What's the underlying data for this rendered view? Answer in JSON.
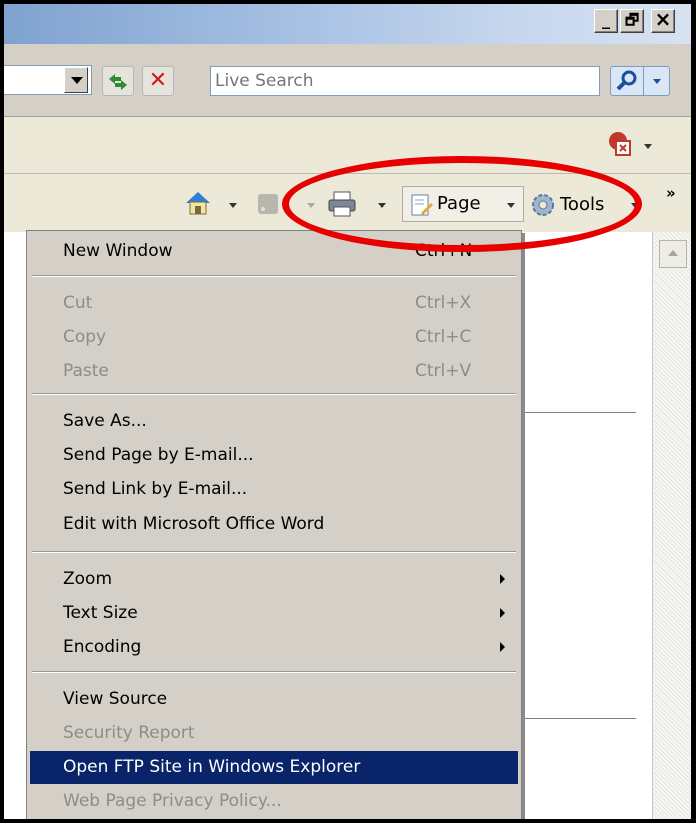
{
  "window": {
    "minimize_label": "_",
    "restore_label": "🗗",
    "close_label": "×"
  },
  "address_bar": {
    "search_placeholder": "Live Search",
    "refresh_icon": "refresh-icon",
    "stop_icon": "stop-icon",
    "search_icon": "magnifier-icon"
  },
  "command_bar": {
    "page_label": "Page",
    "tools_label": "Tools",
    "overflow_label": "»"
  },
  "menu": {
    "items": [
      {
        "label": "New Window",
        "shortcut": "Ctrl+N",
        "disabled": false
      },
      {
        "label": "Cut",
        "shortcut": "Ctrl+X",
        "disabled": true
      },
      {
        "label": "Copy",
        "shortcut": "Ctrl+C",
        "disabled": true
      },
      {
        "label": "Paste",
        "shortcut": "Ctrl+V",
        "disabled": true
      },
      {
        "label": "Save As...",
        "shortcut": "",
        "disabled": false
      },
      {
        "label": "Send Page by E-mail...",
        "shortcut": "",
        "disabled": false
      },
      {
        "label": "Send Link by E-mail...",
        "shortcut": "",
        "disabled": false
      },
      {
        "label": "Edit with Microsoft Office Word",
        "shortcut": "",
        "disabled": false
      },
      {
        "label": "Zoom",
        "shortcut": "",
        "disabled": false,
        "submenu": true
      },
      {
        "label": "Text Size",
        "shortcut": "",
        "disabled": false,
        "submenu": true
      },
      {
        "label": "Encoding",
        "shortcut": "",
        "disabled": false,
        "submenu": true
      },
      {
        "label": "View Source",
        "shortcut": "",
        "disabled": false
      },
      {
        "label": "Security Report",
        "shortcut": "",
        "disabled": true
      },
      {
        "label": "Open FTP Site in Windows Explorer",
        "shortcut": "",
        "disabled": false,
        "selected": true
      },
      {
        "label": "Web Page Privacy Policy...",
        "shortcut": "",
        "disabled": true
      }
    ]
  },
  "colors": {
    "highlight": "#0a246a",
    "annotation": "#e60000",
    "menu_bg": "#d4d0c8"
  }
}
